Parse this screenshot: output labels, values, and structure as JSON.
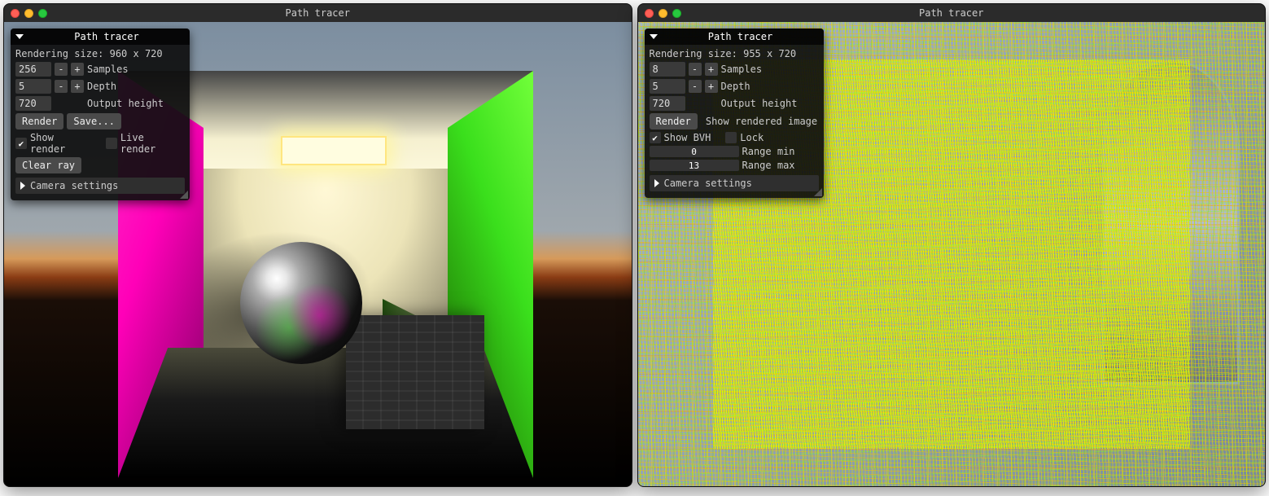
{
  "windowTitle": "Path tracer",
  "left": {
    "panelTitle": "Path tracer",
    "renderingSize": "Rendering size: 960 x 720",
    "samples": {
      "value": "256",
      "label": "Samples"
    },
    "depth": {
      "value": "5",
      "label": "Depth"
    },
    "outputHeight": {
      "value": "720",
      "label": "Output height"
    },
    "renderBtn": "Render",
    "saveBtn": "Save...",
    "showRenderChecked": true,
    "showRenderLabel": "Show render",
    "liveRenderChecked": false,
    "liveRenderLabel": "Live render",
    "clearRayBtn": "Clear ray",
    "cameraSection": "Camera settings",
    "minus": "-",
    "plus": "+"
  },
  "right": {
    "panelTitle": "Path tracer",
    "renderingSize": "Rendering size: 955 x 720",
    "samples": {
      "value": "8",
      "label": "Samples"
    },
    "depth": {
      "value": "5",
      "label": "Depth"
    },
    "outputHeight": {
      "value": "720",
      "label": "Output height"
    },
    "renderBtn": "Render",
    "showRenderedBtn": "Show rendered image",
    "showBvhChecked": true,
    "showBvhLabel": "Show BVH",
    "lockChecked": false,
    "lockLabel": "Lock",
    "rangeMin": {
      "value": "0",
      "label": "Range min"
    },
    "rangeMax": {
      "value": "13",
      "label": "Range max"
    },
    "cameraSection": "Camera settings",
    "minus": "-",
    "plus": "+"
  }
}
